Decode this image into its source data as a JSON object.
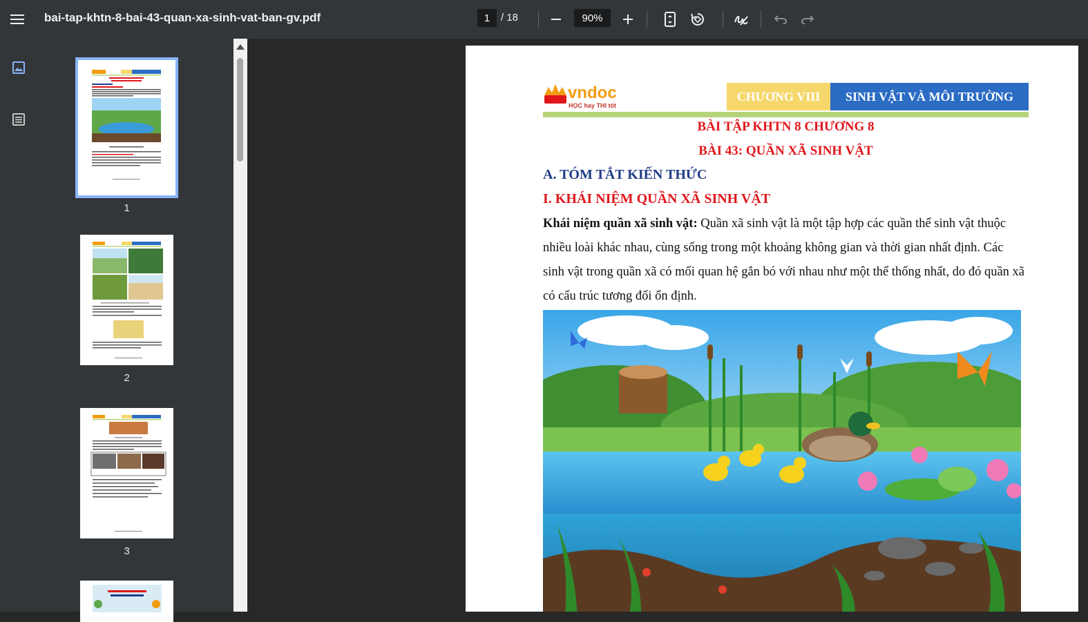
{
  "toolbar": {
    "title": "bai-tap-khtn-8-bai-43-quan-xa-sinh-vat-ban-gv.pdf",
    "current_page": "1",
    "total_pages": "/ 18",
    "zoom": "90%"
  },
  "sidebar": {
    "thumbnails": [
      {
        "label": "1",
        "selected": true
      },
      {
        "label": "2",
        "selected": false
      },
      {
        "label": "3",
        "selected": false
      }
    ]
  },
  "document": {
    "logo_text": "vndoc",
    "logo_tagline": "HỌC hay THI tốt",
    "chapter_label": "CHƯƠNG VIII",
    "topic_label": "SINH VẬT VÀ MÔI TRƯỜNG",
    "title_line1": "BÀI TẬP KHTN 8 CHƯƠNG 8",
    "title_line2": "BÀI 43: QUẦN XÃ SINH VẬT",
    "section_a": "A. TÓM TẮT KIẾN THỨC",
    "section_i": "I. KHÁI NIỆM QUẦN XÃ SINH VẬT",
    "definition_term": "Khái niệm quần xã sinh vật:",
    "definition_text": " Quần xã sinh vật là một tập hợp các quần thể sinh vật thuộc nhiều loài khác nhau, cùng sống trong một khoảng không gian và thời gian nhất định. Các sinh vật trong quần xã có mối quan hệ gắn bó với nhau như một thể thống nhất, do đó quần xã có cấu trúc tương đối ổn định."
  },
  "colors": {
    "toolbar_bg": "#323639",
    "viewer_bg": "#282828",
    "accent_red": "#e0161b",
    "accent_blue": "#2b6cc4",
    "chapter_yellow": "#f6d76b"
  }
}
